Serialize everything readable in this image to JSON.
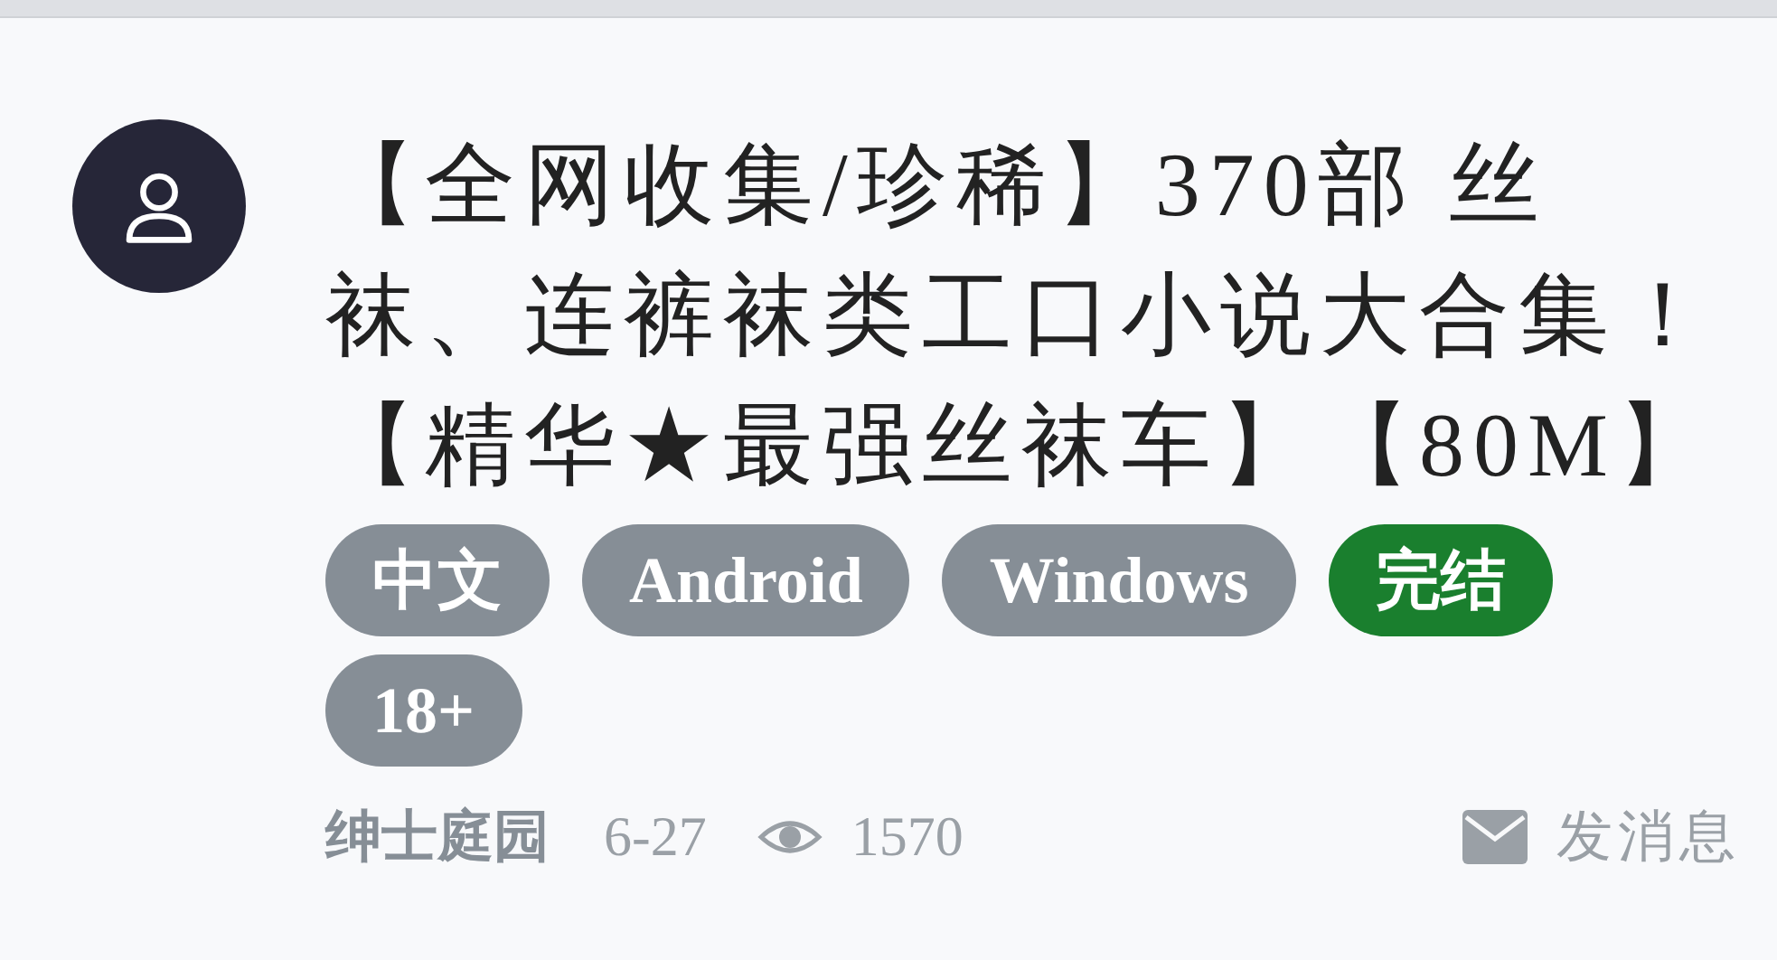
{
  "post": {
    "title": "【全网收集/珍稀】370部 丝袜、连裤袜类工口小说大合集！【精华★最强丝袜车】【80M】",
    "tags": [
      {
        "label": "中文",
        "color": "#868e96"
      },
      {
        "label": "Android",
        "color": "#868e96"
      },
      {
        "label": "Windows",
        "color": "#868e96"
      },
      {
        "label": "完结",
        "color": "#1a7f2e"
      },
      {
        "label": "18+",
        "color": "#868e96"
      }
    ],
    "author": "绅士庭园",
    "date": "6-27",
    "views": "1570",
    "message_link": "发消息"
  }
}
